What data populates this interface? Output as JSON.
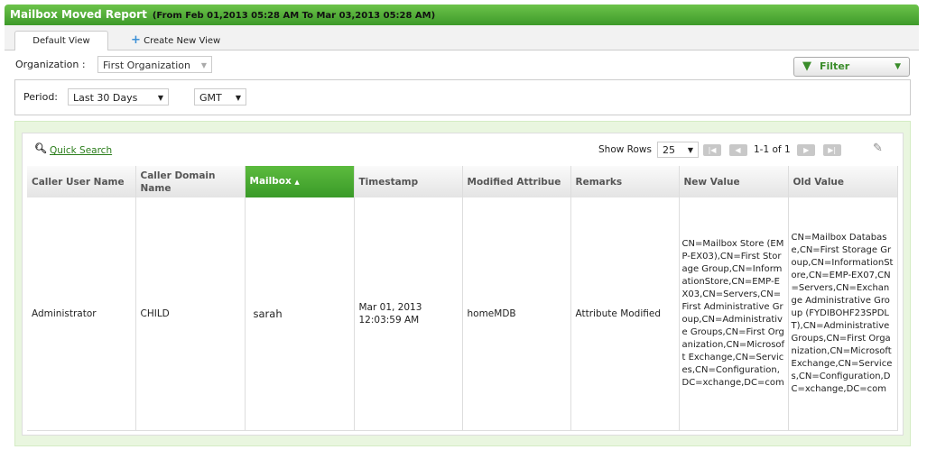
{
  "title": "Mailbox Moved Report",
  "range": "(From Feb 01,2013 05:28 AM To Mar 03,2013 05:28 AM)",
  "tabs": {
    "default": "Default View",
    "create": "Create New View"
  },
  "org": {
    "label": "Organization :",
    "value": "First Organization"
  },
  "filter": "Filter",
  "period": {
    "label": "Period:",
    "value": "Last 30 Days",
    "tz": "GMT"
  },
  "toolbar": {
    "quick_search": "Quick Search",
    "show_rows": "Show Rows",
    "rows": "25",
    "page_info": "1-1 of 1"
  },
  "columns": [
    "Caller User Name",
    "Caller Domain Name",
    "Mailbox",
    "Timestamp",
    "Modified Attribue",
    "Remarks",
    "New Value",
    "Old Value"
  ],
  "rows": [
    [
      "Administrator",
      "CHILD",
      "sarah",
      "Mar 01, 2013 12:03:59 AM",
      "homeMDB",
      "Attribute Modified",
      "CN=Mailbox Store (EMP-EX03),CN=First Storage Group,CN=InformationStore,CN=EMP-EX03,CN=Servers,CN=First Administrative Group,CN=Administrative Groups,CN=First Organization,CN=Microsoft Exchange,CN=Services,CN=Configuration,DC=xchange,DC=com",
      "CN=Mailbox Database,CN=First Storage Group,CN=InformationStore,CN=EMP-EX07,CN=Servers,CN=Exchange Administrative Group (FYDIBOHF23SPDLT),CN=Administrative Groups,CN=First Organization,CN=Microsoft Exchange,CN=Services,CN=Configuration,DC=xchange,DC=com"
    ]
  ]
}
